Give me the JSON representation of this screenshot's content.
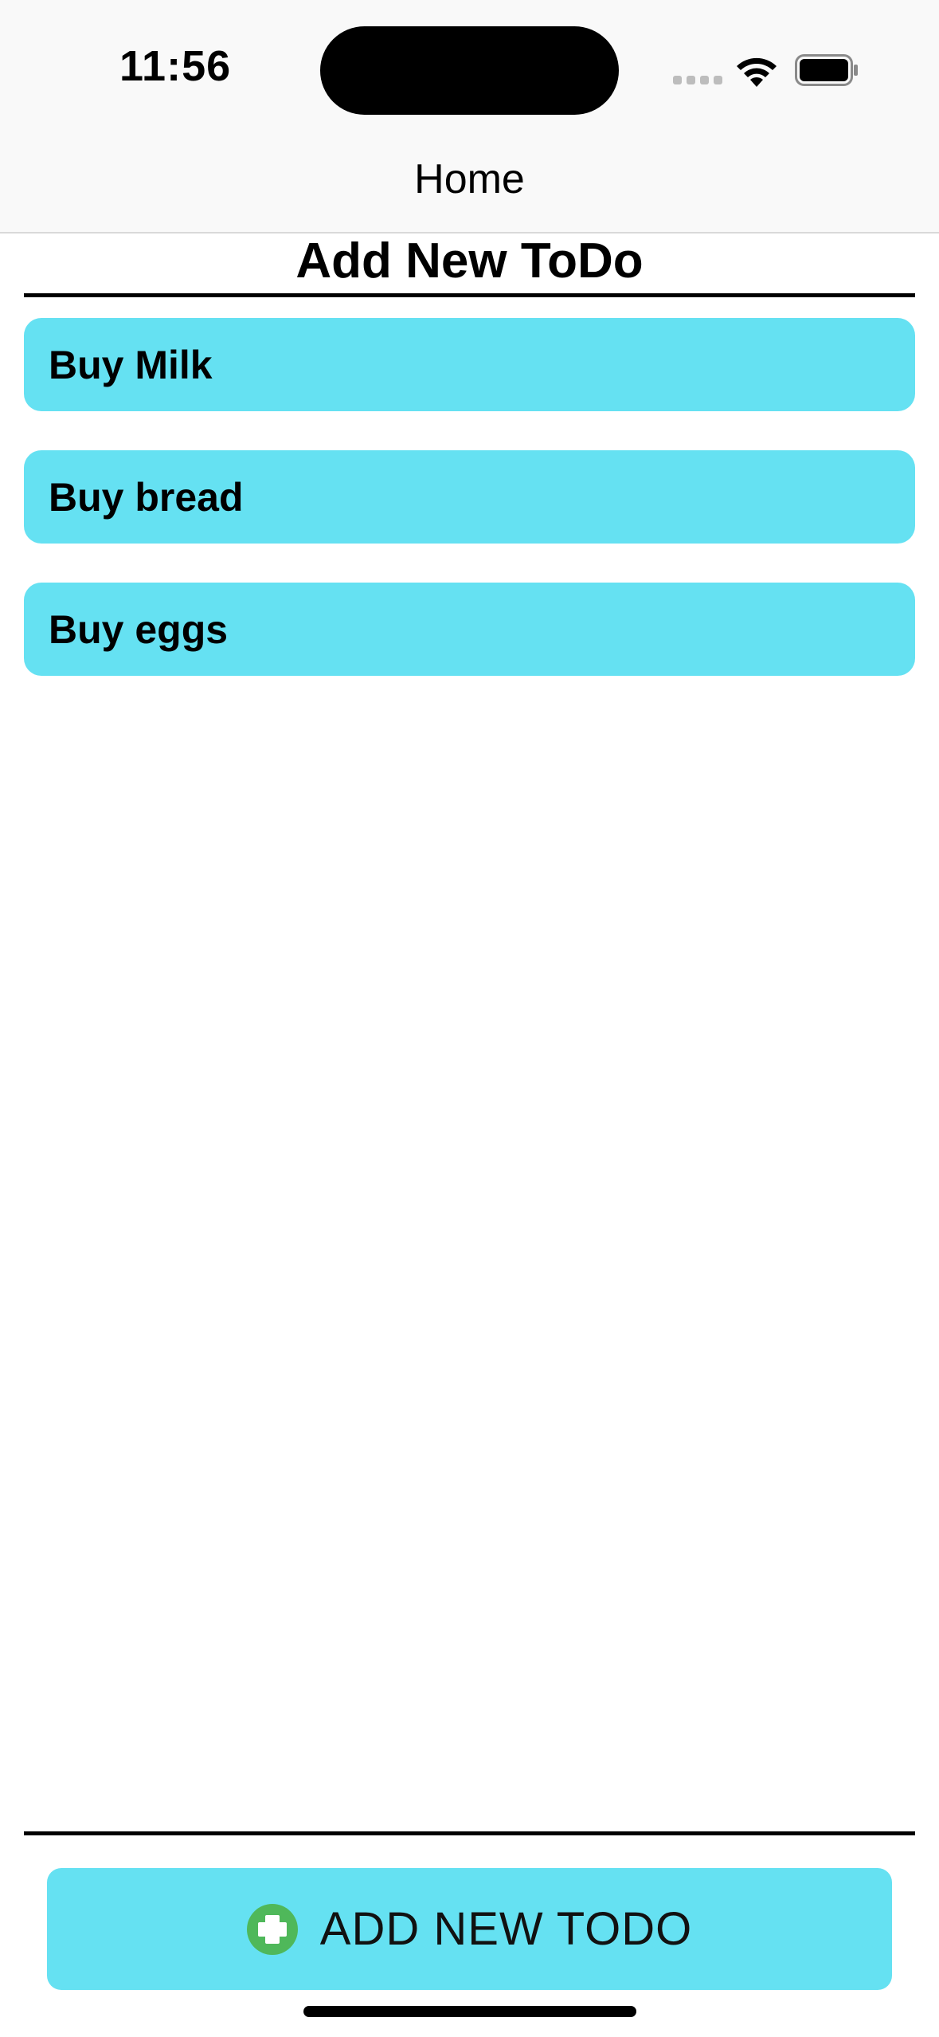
{
  "status_bar": {
    "time": "11:56",
    "icons": [
      "cellular-signal-icon",
      "wifi-icon",
      "battery-icon"
    ]
  },
  "nav": {
    "title": "Home"
  },
  "main": {
    "section_title": "Add New ToDo",
    "todos": [
      {
        "text": "Buy Milk"
      },
      {
        "text": "Buy bread"
      },
      {
        "text": "Buy eggs"
      }
    ],
    "add_button": {
      "label": "ADD NEW TODO",
      "icon": "plus-circle-icon"
    }
  },
  "colors": {
    "item_background": "#65e1f2",
    "button_background": "#65e1f2",
    "plus_icon": "#4fb85a",
    "nav_background": "#f9f9f9"
  }
}
